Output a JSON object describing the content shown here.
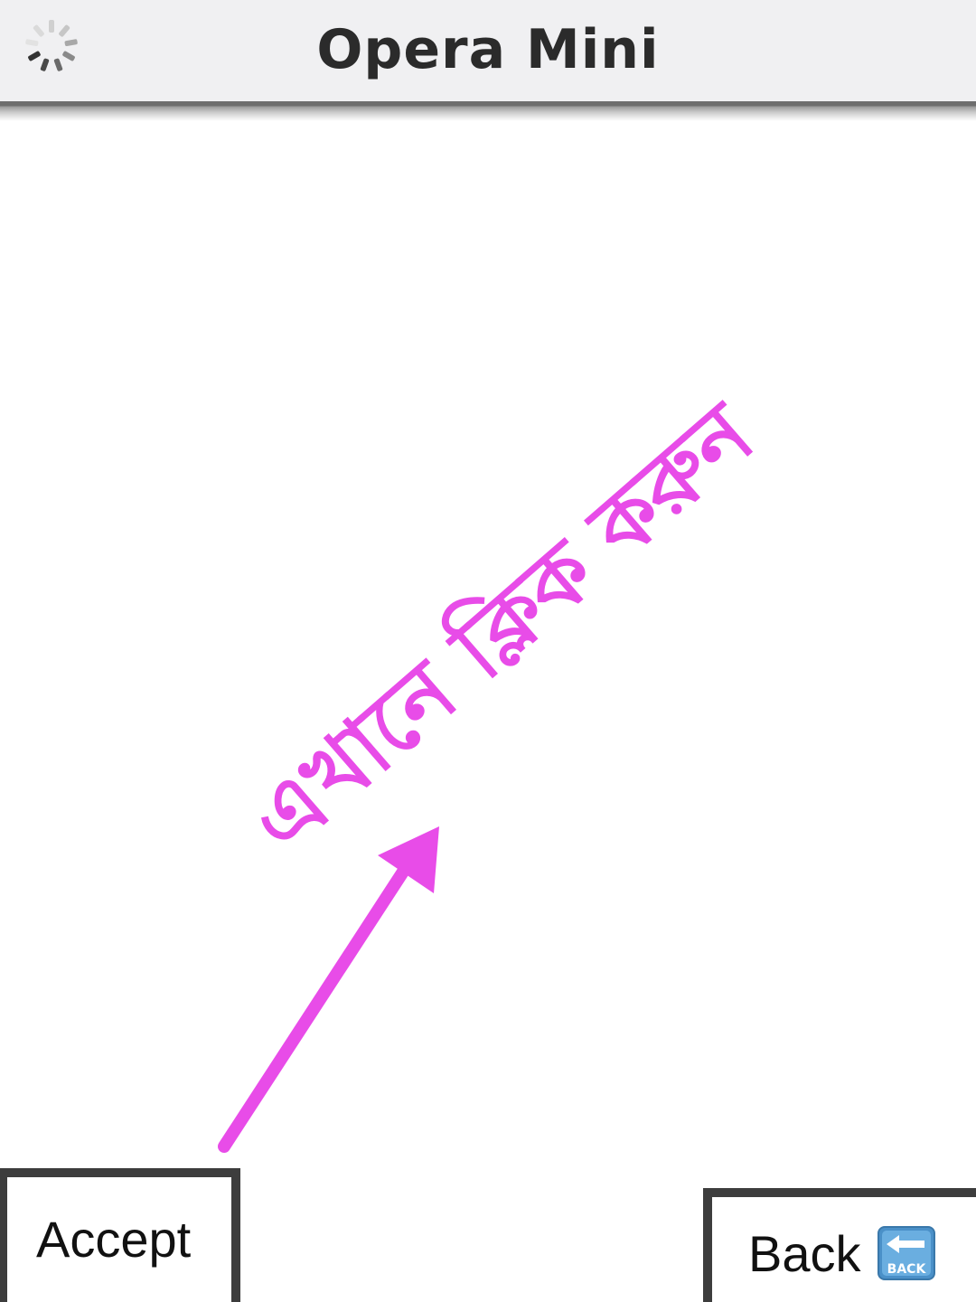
{
  "header": {
    "title": "Opera Mini",
    "loading_icon": "loading-spinner-icon"
  },
  "annotation": {
    "text": "এখানে ক্লিক করুন",
    "color": "#e84ce8",
    "arrow_icon": "arrow-icon"
  },
  "softkeys": {
    "accept_label": "Accept",
    "back_label": "Back",
    "back_icon": "back-arrow-icon",
    "back_icon_text": "BACK"
  }
}
